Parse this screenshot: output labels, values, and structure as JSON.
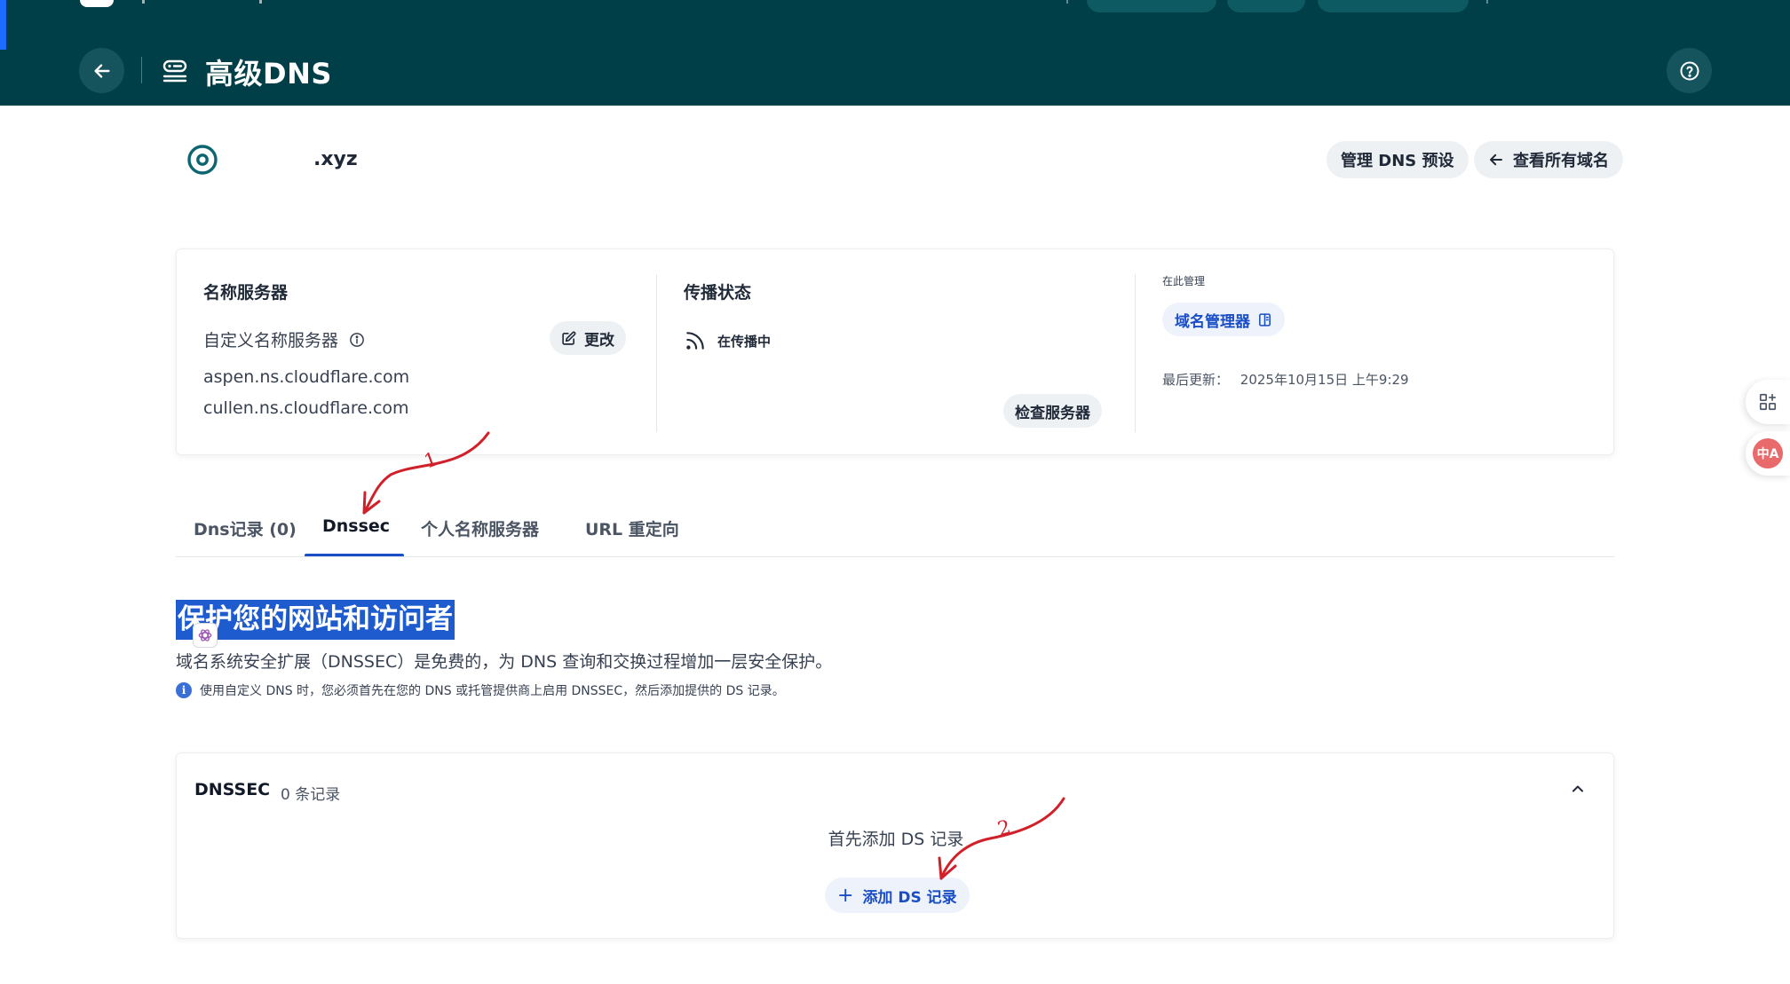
{
  "header": {
    "title": "高级DNS",
    "back_icon": "arrow-left-icon",
    "dns_icon": "dns-server-icon",
    "help_icon": "help-circle-icon"
  },
  "domain": {
    "name": ".xyz",
    "icon": "target-icon"
  },
  "actions": {
    "manage_presets": "管理 DNS 预设",
    "view_all_domains": "查看所有域名"
  },
  "nameservers": {
    "heading": "名称服务器",
    "type_label": "自定义名称服务器",
    "edit_label": "更改",
    "servers": [
      "aspen.ns.cloudflare.com",
      "cullen.ns.cloudflare.com"
    ]
  },
  "propagation": {
    "heading": "传播状态",
    "status": "在传播中",
    "check_label": "检查服务器"
  },
  "managed": {
    "caption": "在此管理",
    "link_label": "域名管理器",
    "last_updated_label": "最后更新：",
    "last_updated_value": "2025年10月15日 上午9:29"
  },
  "tabs": [
    {
      "label": "Dns记录 (0)",
      "active": false
    },
    {
      "label": "Dnssec",
      "active": true
    },
    {
      "label": "个人名称服务器",
      "active": false
    },
    {
      "label": "URL 重定向",
      "active": false
    }
  ],
  "section": {
    "title": "保护您的网站和访问者",
    "description": "域名系统安全扩展（DNSSEC）是免费的，为 DNS 查询和交换过程增加一层安全保护。",
    "note": "使用自定义 DNS 时，您必须首先在您的 DNS 或托管提供商上启用 DNSSEC，然后添加提供的 DS 记录。"
  },
  "dnssec_panel": {
    "label": "DNSSEC",
    "count": "0 条记录",
    "empty_text": "首先添加 DS 记录",
    "add_button": "添加 DS 记录"
  },
  "annotations": {
    "marker_1": "1",
    "marker_2": "2",
    "color": "#d0212a"
  },
  "side_tools": {
    "grid_icon": "grid-add-icon",
    "translate_label": "中A"
  },
  "colors": {
    "header_bg": "#003f47",
    "accent_blue": "#1a4ec7",
    "selection_blue": "#1e5bcf"
  }
}
